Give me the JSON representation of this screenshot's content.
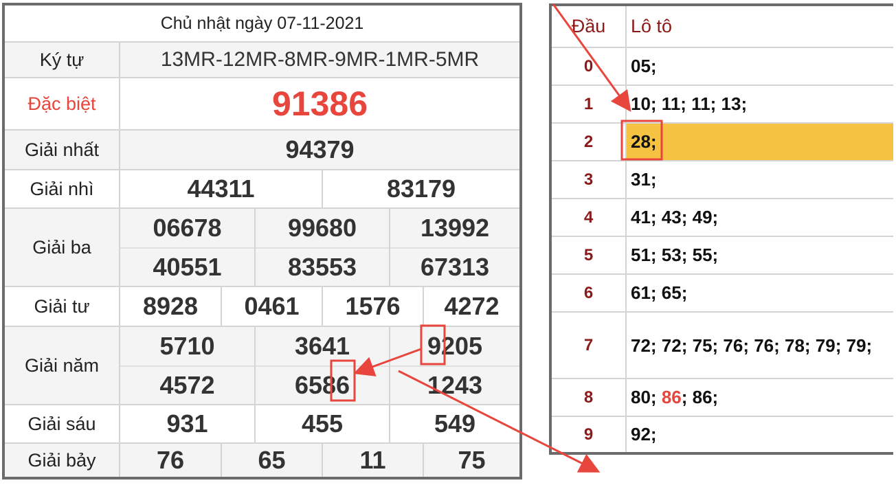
{
  "results": {
    "title": "Chủ nhật ngày 07-11-2021",
    "ky_tu": {
      "label": "Ký tự",
      "value": "13MR-12MR-8MR-9MR-1MR-5MR"
    },
    "dac_biet": {
      "label": "Đặc biệt",
      "value": "91386"
    },
    "giai_nhat": {
      "label": "Giải nhất",
      "values": [
        "94379"
      ]
    },
    "giai_nhi": {
      "label": "Giải nhì",
      "values": [
        "44311",
        "83179"
      ]
    },
    "giai_ba": {
      "label": "Giải ba",
      "values": [
        "06678",
        "99680",
        "13992",
        "40551",
        "83553",
        "67313"
      ]
    },
    "giai_tu": {
      "label": "Giải tư",
      "values": [
        "8928",
        "0461",
        "1576",
        "4272"
      ]
    },
    "giai_nam": {
      "label": "Giải năm",
      "values": [
        "5710",
        "3641",
        "9205",
        "4572",
        "6586",
        "1243"
      ]
    },
    "giai_sau": {
      "label": "Giải sáu",
      "values": [
        "931",
        "455",
        "549"
      ]
    },
    "giai_bay": {
      "label": "Giải bảy",
      "values": [
        "76",
        "65",
        "11",
        "75"
      ]
    }
  },
  "loto": {
    "header_dau": "Đầu",
    "header_loto": "Lô tô",
    "rows": [
      {
        "dau": "0",
        "loto": "05;"
      },
      {
        "dau": "1",
        "loto": "10; 11; 11; 13;"
      },
      {
        "dau": "2",
        "loto": "28;"
      },
      {
        "dau": "3",
        "loto": "31;"
      },
      {
        "dau": "4",
        "loto": "41; 43; 49;"
      },
      {
        "dau": "5",
        "loto": "51; 53; 55;"
      },
      {
        "dau": "6",
        "loto": "61; 65;"
      },
      {
        "dau": "7",
        "loto": "72; 72; 75; 76; 76; 78; 79; 79;"
      },
      {
        "dau": "8",
        "loto_before": "80; ",
        "loto_highlight": "86",
        "loto_after": "; 86;"
      },
      {
        "dau": "9",
        "loto": "92;"
      }
    ]
  },
  "colors": {
    "special_red": "#e8453c",
    "head_dark_red": "#8b1a1a",
    "highlight_yellow": "#f5c242",
    "annotation_red": "#e8453c"
  }
}
